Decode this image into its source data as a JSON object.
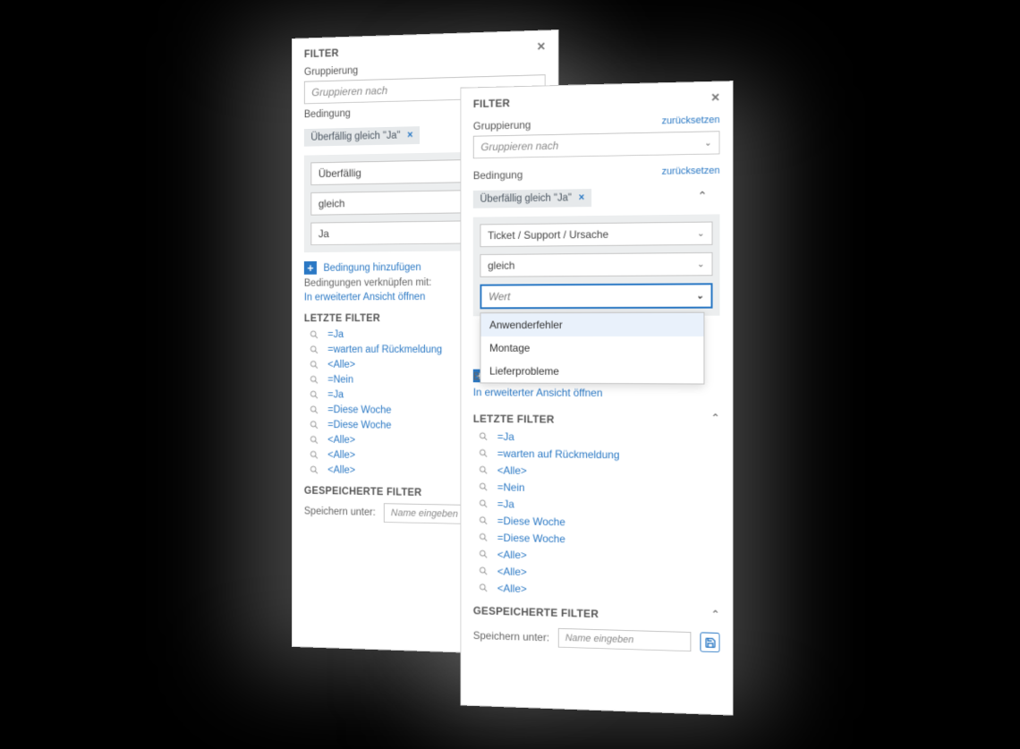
{
  "common": {
    "title": "FILTER",
    "grouping_label": "Gruppierung",
    "group_by_placeholder": "Gruppieren nach",
    "condition_label": "Bedingung",
    "reset": "zurücksetzen",
    "chip": "Überfällig gleich \"Ja\"",
    "add_condition": "Bedingung hinzufügen",
    "combine_label": "Bedingungen verknüpfen mit:",
    "open_advanced": "In erweiterter Ansicht öffnen",
    "recent_title": "LETZTE FILTER",
    "saved_title": "GESPEICHERTE FILTER",
    "save_as_label": "Speichern unter:",
    "save_placeholder": "Name eingeben"
  },
  "back_editor": {
    "field": "Überfällig",
    "op": "gleich",
    "val": "Ja"
  },
  "front_editor": {
    "field": "Ticket / Support / Ursache",
    "op": "gleich",
    "val_placeholder": "Wert",
    "options": [
      "Anwenderfehler",
      "Montage",
      "Lieferprobleme"
    ]
  },
  "recent_filters": [
    "=Ja",
    "=warten auf Rückmeldung",
    "<Alle>",
    "=Nein",
    "=Ja",
    "=Diese Woche",
    "=Diese Woche",
    "<Alle>",
    "<Alle>",
    "<Alle>"
  ]
}
